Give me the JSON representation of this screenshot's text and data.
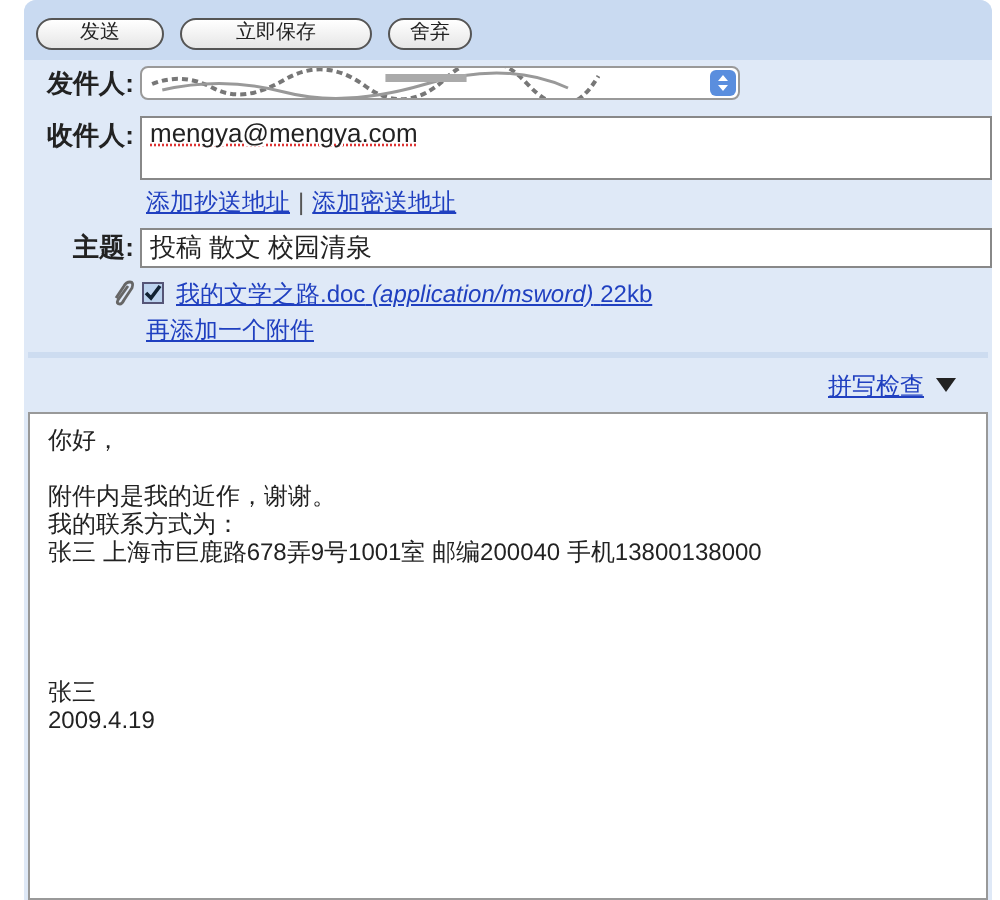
{
  "toolbar": {
    "buttons": [
      "发送",
      "立即保存",
      "舍弃"
    ]
  },
  "from": {
    "label": "发件人:"
  },
  "to": {
    "label": "收件人:",
    "value": "mengya@mengya.com"
  },
  "address_links": [
    "添加抄送地址",
    "添加密送地址"
  ],
  "address_separator": "|",
  "subject": {
    "label": "主题:",
    "value": "投稿 散文 校园清泉"
  },
  "attachment": {
    "checked": true,
    "name": "我的文学之路.doc",
    "type": "(application/msword)",
    "size": "22kb"
  },
  "add_attachment": "再添加一个附件",
  "spell_check": "拼写检查",
  "body": {
    "paragraphs": [
      [
        "你好，"
      ],
      [
        "附件内是我的近作，谢谢。",
        "我的联系方式为：",
        "张三 上海市巨鹿路678弄9号1001室 邮编200040 手机13800138000"
      ],
      [
        "张三",
        "2009.4.19"
      ]
    ]
  }
}
